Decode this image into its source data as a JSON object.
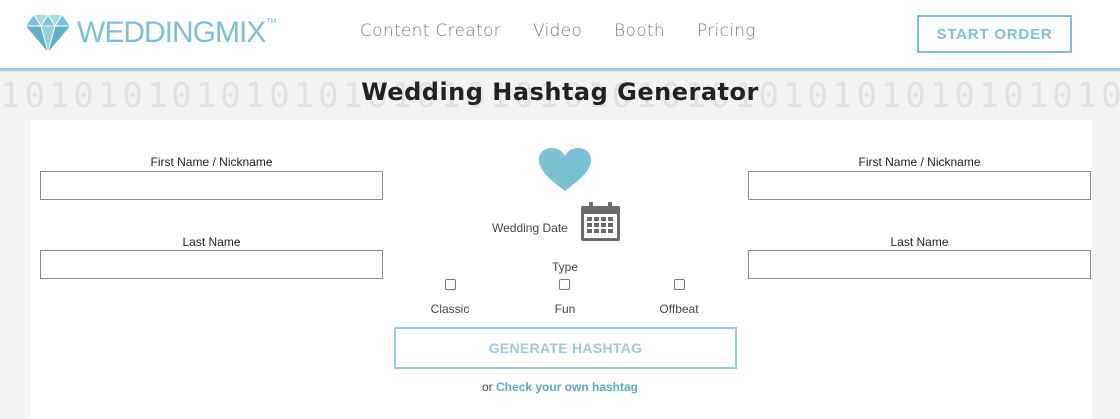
{
  "brand": {
    "name": "WEDDINGMIX",
    "tm": "TM",
    "accent": "#80c1d5"
  },
  "nav": {
    "items": [
      "Content Creator",
      "Video",
      "Booth",
      "Pricing"
    ],
    "cta": "START ORDER"
  },
  "pattern": {
    "digits": "1010101010101010101010101010101010101010101010101010"
  },
  "page": {
    "title": "Wedding Hashtag Generator"
  },
  "form": {
    "left": {
      "first_label": "First Name / Nickname",
      "last_label": "Last Name",
      "first_value": "",
      "last_value": ""
    },
    "right": {
      "first_label": "First Name / Nickname",
      "last_label": "Last Name",
      "first_value": "",
      "last_value": ""
    },
    "heart_icon": "heart-icon",
    "date_label": "Wedding Date",
    "calendar_icon": "calendar-icon",
    "type_label": "Type",
    "types": [
      "Classic",
      "Fun",
      "Offbeat"
    ],
    "generate_label": "GENERATE HASHTAG",
    "or_text": "or",
    "check_link": "Check your own hashtag"
  }
}
